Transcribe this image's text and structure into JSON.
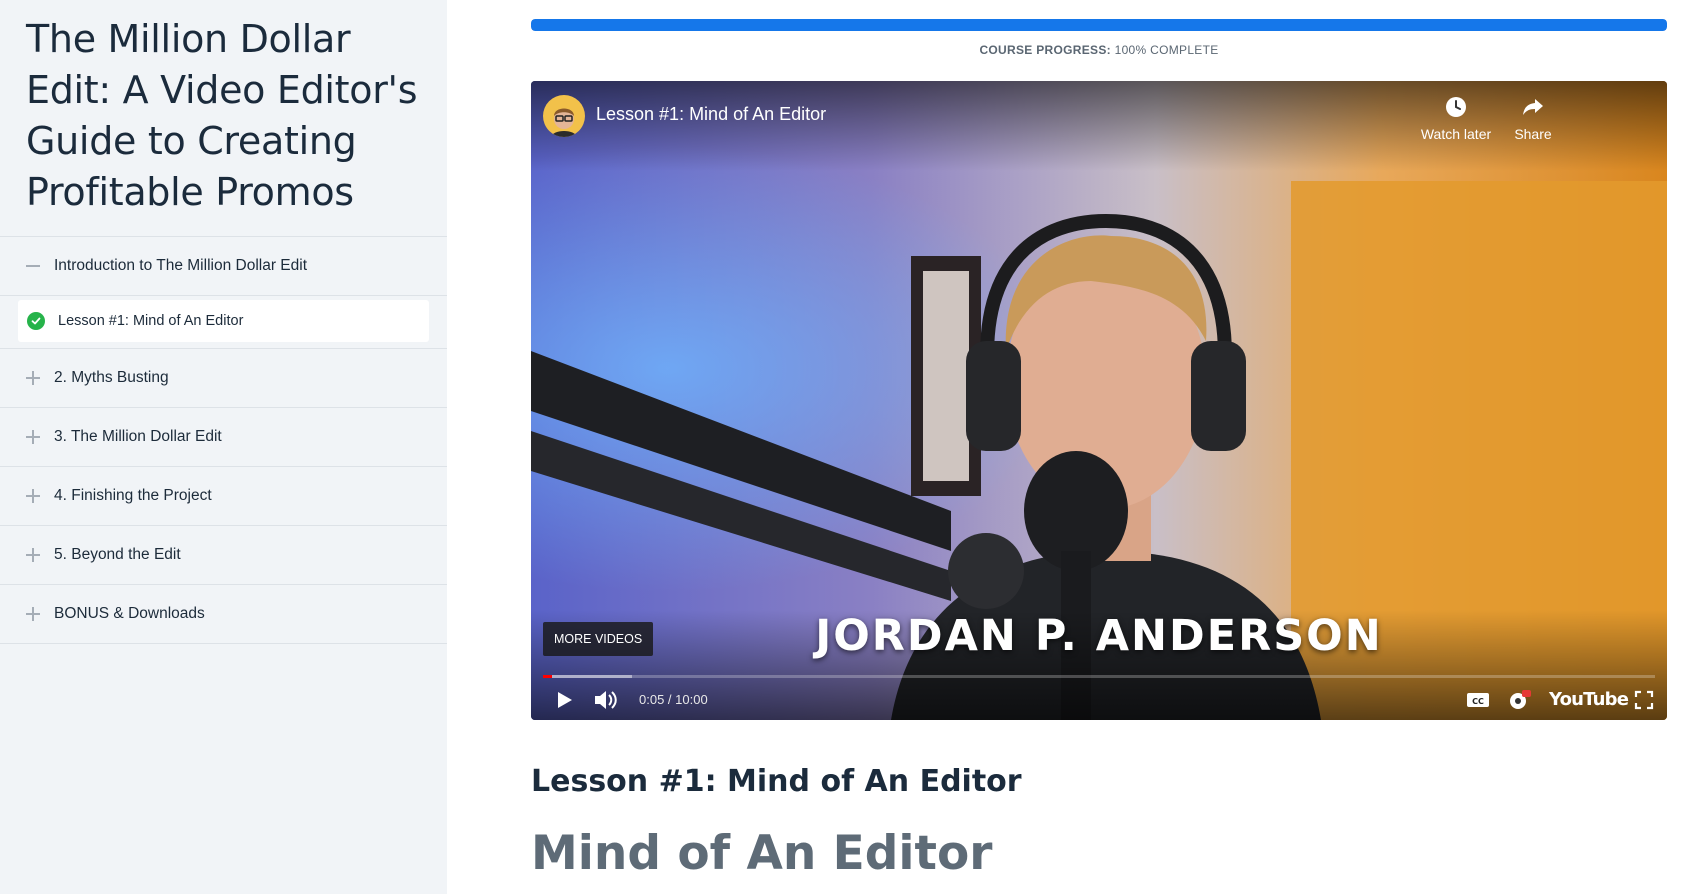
{
  "sidebar": {
    "course_title": "The Million Dollar Edit: A Video Editor's Guide to Creating Profitable Promos",
    "sections": [
      {
        "label": "Introduction to The Million Dollar Edit",
        "state": "expanded"
      },
      {
        "label": "2. Myths Busting",
        "state": "collapsed"
      },
      {
        "label": "3. The Million Dollar Edit",
        "state": "collapsed"
      },
      {
        "label": "4. Finishing the Project",
        "state": "collapsed"
      },
      {
        "label": "5. Beyond the Edit",
        "state": "collapsed"
      },
      {
        "label": "BONUS & Downloads",
        "state": "collapsed"
      }
    ],
    "active_lesson": {
      "label": "Lesson #1: Mind of An Editor",
      "status": "completed"
    }
  },
  "progress": {
    "label": "COURSE PROGRESS:",
    "value_text": "100% COMPLETE",
    "percent": 100,
    "color": "#1577ea"
  },
  "video": {
    "title": "Lesson #1: Mind of An Editor",
    "watch_later_label": "Watch later",
    "share_label": "Share",
    "more_videos_label": "MORE VIDEOS",
    "lower_third": "JORDAN P. ANDERSON",
    "time": "0:05 / 10:00",
    "played_fraction": 0.008,
    "brand_label": "YouTube"
  },
  "content": {
    "lesson_heading": "Lesson #1: Mind of An Editor",
    "section_heading": "Mind of An Editor"
  }
}
